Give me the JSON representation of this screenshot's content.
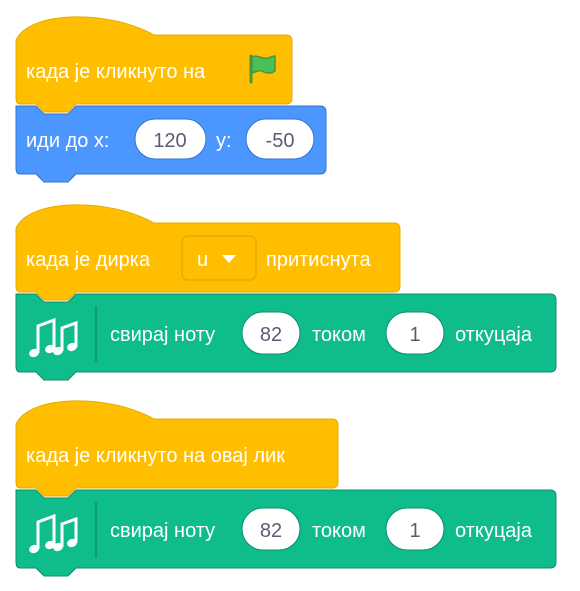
{
  "colors": {
    "events": "#ffbf00",
    "events_border": "#e6ac00",
    "motion": "#4c97ff",
    "motion_border": "#3373cc",
    "music": "#0fbd8c",
    "music_border": "#0b8e69",
    "input_text": "#575e75",
    "flag": "#4cbf56"
  },
  "script1": {
    "hat_label": "када је кликнуто на",
    "hat_icon": "green-flag-icon",
    "goto": {
      "label_prefix": "иди до x:",
      "x_value": "120",
      "y_label": "y:",
      "y_value": "-50"
    }
  },
  "script2": {
    "hat_label_before": "када је дирка",
    "key_value": "u",
    "key_dropdown_icon": "caret-down-icon",
    "hat_label_after": "притиснута",
    "play_note": {
      "icon": "music-notes-icon",
      "label_play": "свирај ноту",
      "note_value": "82",
      "label_for": "током",
      "beats_value": "1",
      "label_beats": "откуцаја"
    }
  },
  "script3": {
    "hat_label": "када је кликнуто на овај лик",
    "play_note": {
      "icon": "music-notes-icon",
      "label_play": "свирај ноту",
      "note_value": "82",
      "label_for": "током",
      "beats_value": "1",
      "label_beats": "откуцаја"
    }
  }
}
